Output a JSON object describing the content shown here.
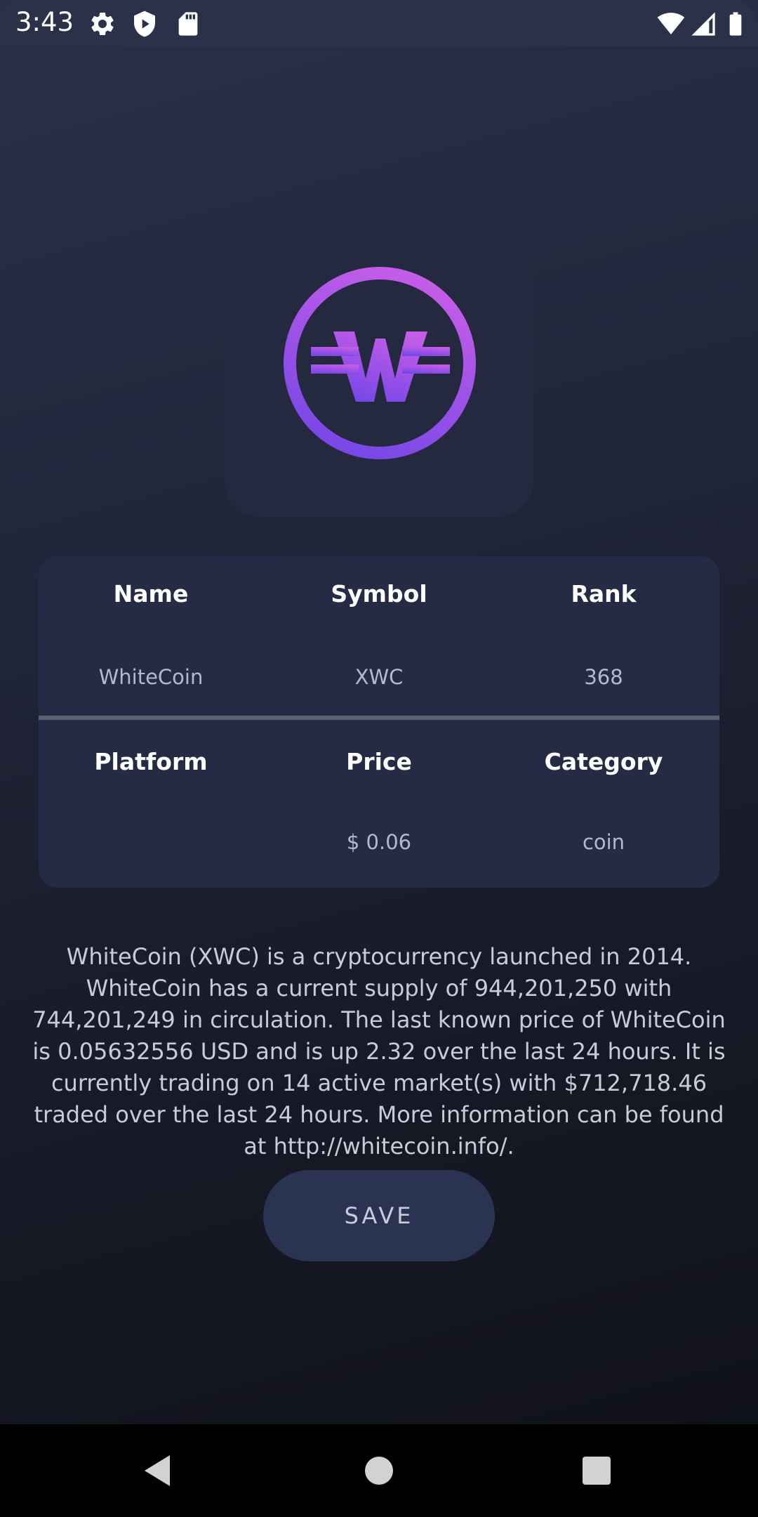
{
  "status_bar": {
    "time": "3:43",
    "left_icons": [
      "gear-icon",
      "shield-icon",
      "sd-card-icon"
    ],
    "right_icons": [
      "wifi-icon",
      "signal-icon",
      "battery-icon"
    ]
  },
  "coin": {
    "logo_icon": "whitecoin-logo-icon",
    "logo_gradient": [
      "#c65de8",
      "#7747e6"
    ]
  },
  "table": {
    "headers_row1": [
      "Name",
      "Symbol",
      "Rank"
    ],
    "values_row1": [
      "WhiteCoin",
      "XWC",
      "368"
    ],
    "headers_row2": [
      "Platform",
      "Price",
      "Category"
    ],
    "values_row2": [
      "",
      "$ 0.06",
      "coin"
    ]
  },
  "description": "WhiteCoin (XWC) is a cryptocurrency launched in 2014. WhiteCoin has a current supply of 944,201,250 with 744,201,249 in circulation. The last known price of WhiteCoin is 0.05632556 USD and is up 2.32 over the last 24 hours. It is currently trading on 14 active market(s) with $712,718.46 traded over the last 24 hours. More information can be found at http://whitecoin.info/.",
  "actions": {
    "save_label": "SAVE"
  },
  "nav_bar": {
    "buttons": [
      "back-icon",
      "home-icon",
      "recents-icon"
    ]
  }
}
